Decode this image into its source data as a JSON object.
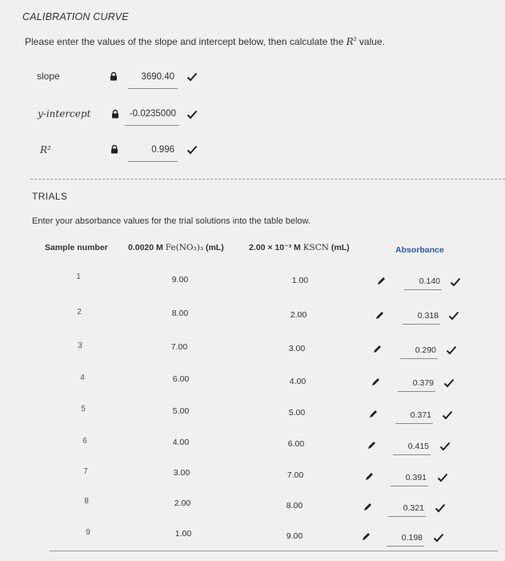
{
  "section_title": "CALIBRATION CURVE",
  "instructions": {
    "before": "Please enter the values of the slope and intercept below, then calculate the ",
    "symbol": "R",
    "superscript": "2",
    "after": " value."
  },
  "calibration": [
    {
      "label": "slope",
      "value": "3690.40"
    },
    {
      "label": "y-intercept",
      "value": "-0.0235000"
    },
    {
      "label": "R²",
      "value": "0.996"
    }
  ],
  "trials": {
    "title": "TRIALS",
    "instructions": "Enter your absorbance values for the trial solutions into the table below.",
    "headers": {
      "sample": "Sample number",
      "fe_prefix": "0.0020 M ",
      "fe_formula": "Fe(NO₃)₃",
      "fe_unit": " (mL)",
      "kscn_prefix": "2.00 × 10⁻³ M ",
      "kscn_formula": "KSCN",
      "kscn_unit": " (mL)",
      "absorbance": "Absorbance"
    },
    "rows": [
      {
        "sample": "1",
        "fe": "9.00",
        "kscn": "1.00",
        "absorbance": "0.140"
      },
      {
        "sample": "2",
        "fe": "8.00",
        "kscn": "2.00",
        "absorbance": "0.318"
      },
      {
        "sample": "3",
        "fe": "7.00",
        "kscn": "3.00",
        "absorbance": "0.290"
      },
      {
        "sample": "4",
        "fe": "6.00",
        "kscn": "4.00",
        "absorbance": "0.379"
      },
      {
        "sample": "5",
        "fe": "5.00",
        "kscn": "5.00",
        "absorbance": "0.371"
      },
      {
        "sample": "6",
        "fe": "4.00",
        "kscn": "6.00",
        "absorbance": "0.415"
      },
      {
        "sample": "7",
        "fe": "3.00",
        "kscn": "7.00",
        "absorbance": "0.391"
      },
      {
        "sample": "8",
        "fe": "2.00",
        "kscn": "8.00",
        "absorbance": "0.321"
      },
      {
        "sample": "9",
        "fe": "1.00",
        "kscn": "9.00",
        "absorbance": "0.198"
      }
    ]
  },
  "icons": {
    "lock": "lock-icon",
    "check": "checkmark-icon",
    "pencil": "pencil-icon"
  },
  "colors": {
    "check": "#222222",
    "absorbance_header": "#2a5aa8"
  }
}
